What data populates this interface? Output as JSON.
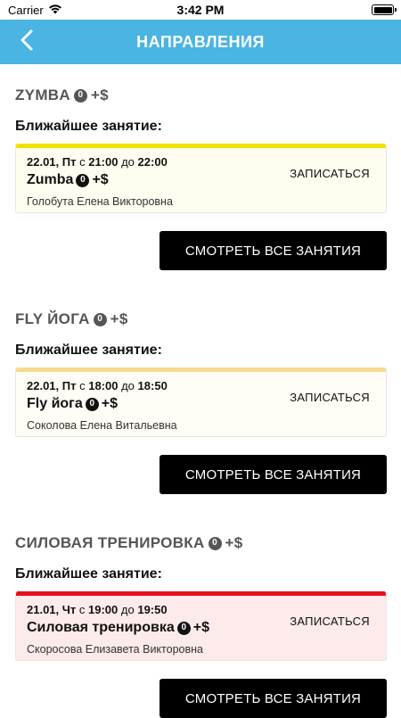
{
  "status_bar": {
    "carrier": "Carrier",
    "time": "3:42 PM"
  },
  "header": {
    "title": "НАПРАВЛЕНИЯ",
    "back_icon": "chevron-left-icon"
  },
  "colors": {
    "accent": "#4ab4e2",
    "zymba_stripe": "#f2e200",
    "zymba_bg": "#fffdf0",
    "fly_stripe": "#f5dc8e",
    "fly_bg": "#fffdf5",
    "power_stripe": "#e8101a",
    "power_bg": "#fdeaea"
  },
  "sections": [
    {
      "title": "ZYMBA",
      "title_suffix": "+$",
      "nearest_label": "Ближайшее занятие:",
      "lesson": {
        "date_day": "22.01, Пт",
        "from_label": "с",
        "start": "21:00",
        "to_label": "до",
        "end": "22:00",
        "name": "Zumba",
        "name_suffix": "+$",
        "trainer": "Голобута Елена Викторовна",
        "action_label": "ЗАПИСАТЬСЯ"
      },
      "all_button_label": "СМОТРЕТЬ ВСЕ ЗАНЯТИЯ"
    },
    {
      "title": "FLY ЙОГА",
      "title_suffix": "+$",
      "nearest_label": "Ближайшее занятие:",
      "lesson": {
        "date_day": "22.01, Пт",
        "from_label": "с",
        "start": "18:00",
        "to_label": "до",
        "end": "18:50",
        "name": "Fly йога",
        "name_suffix": "+$",
        "trainer": "Соколова Елена Витальевна",
        "action_label": "ЗАПИСАТЬСЯ"
      },
      "all_button_label": "СМОТРЕТЬ ВСЕ ЗАНЯТИЯ"
    },
    {
      "title": "СИЛОВАЯ ТРЕНИРОВКА",
      "title_suffix": "+$",
      "nearest_label": "Ближайшее занятие:",
      "lesson": {
        "date_day": "21.01, Чт",
        "from_label": "с",
        "start": "19:00",
        "to_label": "до",
        "end": "19:50",
        "name": "Силовая тренировка",
        "name_suffix": "+$",
        "trainer": "Скоросова Елизавета Викторовна",
        "action_label": "ЗАПИСАТЬСЯ"
      },
      "all_button_label": "СМОТРЕТЬ ВСЕ ЗАНЯТИЯ"
    }
  ]
}
